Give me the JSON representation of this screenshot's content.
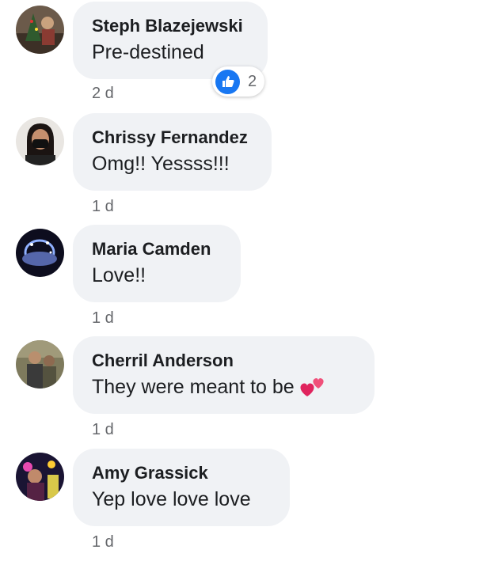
{
  "comments": [
    {
      "author": "Steph Blazejewski",
      "text": "Pre-destined",
      "time": "2 d",
      "reaction": {
        "icon": "like-icon",
        "count": "2",
        "color": "#1877f2"
      }
    },
    {
      "author": "Chrissy Fernandez",
      "text": "Omg!! Yessss!!!",
      "time": "1 d"
    },
    {
      "author": "Maria Camden",
      "text": "Love!!",
      "time": "1 d"
    },
    {
      "author": "Cherril Anderson",
      "text": "They were meant to be",
      "emoji": "two-hearts-icon",
      "time": "1 d"
    },
    {
      "author": "Amy Grassick",
      "text": "Yep love love love",
      "time": "1 d"
    }
  ],
  "colors": {
    "bubble": "#f0f2f5",
    "author_text": "#1c1e21",
    "timestamp_text": "#65676b",
    "like_blue": "#1877f2"
  }
}
